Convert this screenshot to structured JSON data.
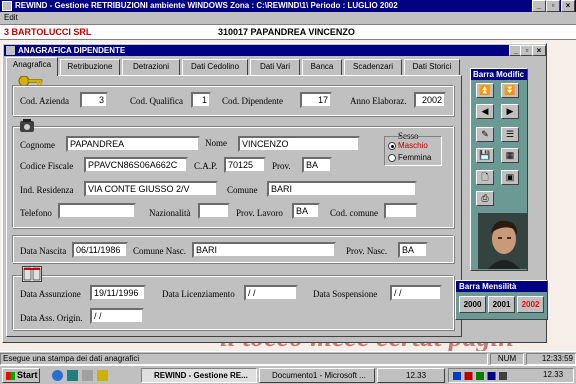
{
  "main_window": {
    "title": "REWIND - Gestione RETRIBUZIONI ambiente WINDOWS     Zona : C:\\REWIND\\1\\   Periodo : LUGLIO 2002",
    "menu": [
      "Edit"
    ]
  },
  "company_bar": {
    "company": "3  BARTOLUCCI  SRL",
    "employee": "310017   PAPANDREA VINCENZO"
  },
  "child_window": {
    "title": "ANAGRAFICA DIPENDENTE"
  },
  "tabs": [
    "Anagrafica",
    "Retribuzione",
    "Detrazioni",
    "Dati Cedolino",
    "Dati Vari",
    "Banca",
    "Scadenzari",
    "Dati Storici"
  ],
  "codes": {
    "azienda_label": "Cod. Azienda",
    "azienda": "3",
    "qualifica_label": "Cod. Qualifica",
    "qualifica": "1",
    "dipendente_label": "Cod. Dipendente",
    "dipendente": "17",
    "anno_label": "Anno Elaboraz.",
    "anno": "2002"
  },
  "personal": {
    "cognome_label": "Cognome",
    "cognome": "PAPANDREA",
    "nome_label": "Nome",
    "nome": "VINCENZO",
    "sesso_label": "Sesso",
    "maschio": "Maschio",
    "femmina": "Femmina",
    "cf_label": "Codice Fiscale",
    "cf": "PPAVCN86S06A662C",
    "cap_label": "C.A.P.",
    "cap": "70125",
    "prov_label": "Prov.",
    "prov": "BA",
    "residenza_label": "Ind. Residenza",
    "residenza": "VIA CONTE GIUSSO 2/V",
    "comune_label": "Comune",
    "comune": "BARI",
    "telefono_label": "Telefono",
    "telefono": "",
    "nazionalita_label": "Nazionalità",
    "nazionalita": "",
    "prov_lavoro_label": "Prov. Lavoro",
    "prov_lavoro": "BA",
    "cod_comune_label": "Cod. comune",
    "cod_comune": ""
  },
  "birth": {
    "data_label": "Data Nascita",
    "data": "06/11/1986",
    "comune_label": "Comune Nasc.",
    "comune": "BARI",
    "prov_label": "Prov. Nasc.",
    "prov": "BA"
  },
  "dates": {
    "assunzione_label": "Data Assunzione",
    "assunzione": "19/11/1996",
    "licenziamento_label": "Data Licenziamento",
    "licenziamento": "/ /",
    "sospensione_label": "Data Sospensione",
    "sospensione": "/ /",
    "origin_label": "Data Ass. Origin.",
    "origin": "/ /"
  },
  "toolbar": {
    "title": "Barra Modific"
  },
  "monthly": {
    "title": "Barra Mensilità",
    "years": [
      "2000",
      "2001",
      "2002"
    ]
  },
  "background_text": "il tocco mece certat pagin",
  "status": {
    "message": "Esegue una stampa dei dati anagrafici",
    "num": "NUM",
    "time": "12:33:59"
  },
  "taskbar": {
    "start": "Start",
    "tasks": [
      "REWIND - Gestione RE...",
      "Documento1 - Microsoft ...",
      "12.33"
    ],
    "clock": "12.33"
  },
  "colors": {
    "title_blue": "#000080",
    "company_red": "#c00000",
    "teal_panel": "#6b9a95",
    "year_red": "#ff0000"
  }
}
